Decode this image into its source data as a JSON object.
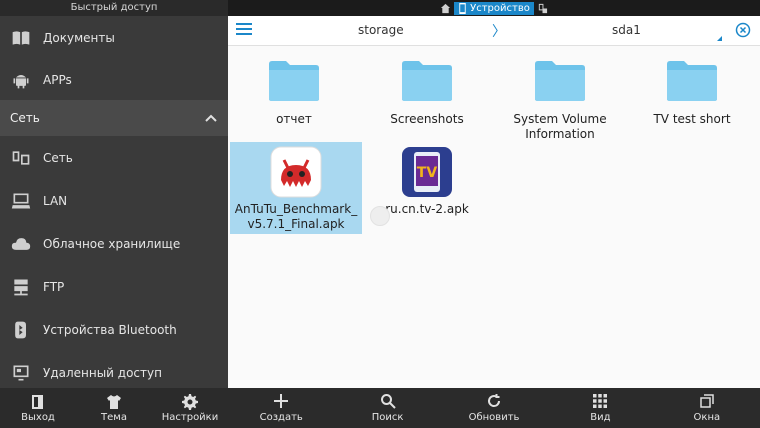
{
  "sidebar": {
    "title": "Быстрый доступ",
    "items_top": [
      {
        "label": "Документы",
        "icon": "book-icon"
      },
      {
        "label": "APPs",
        "icon": "android-icon"
      }
    ],
    "section": {
      "label": "Сеть",
      "expanded": true
    },
    "items_net": [
      {
        "label": "Сеть",
        "icon": "network-devices-icon"
      },
      {
        "label": "LAN",
        "icon": "computer-icon"
      },
      {
        "label": "Облачное хранилище",
        "icon": "cloud-icon"
      },
      {
        "label": "FTP",
        "icon": "ftp-server-icon"
      },
      {
        "label": "Устройства Bluetooth",
        "icon": "bluetooth-icon"
      },
      {
        "label": "Удаленный доступ",
        "icon": "remote-access-icon"
      }
    ],
    "bottom": [
      {
        "label": "Выход",
        "icon": "exit-icon"
      },
      {
        "label": "Тема",
        "icon": "tshirt-icon"
      },
      {
        "label": "Настройки",
        "icon": "gear-icon"
      }
    ]
  },
  "sysbar": {
    "device_label": "Устройство"
  },
  "path": {
    "crumb1": "storage",
    "separator": "〉",
    "crumb2": "sda1"
  },
  "files": [
    {
      "name": "отчет",
      "type": "folder"
    },
    {
      "name": "Screenshots",
      "type": "folder"
    },
    {
      "name": "System Volume Information",
      "type": "folder"
    },
    {
      "name": "TV test short",
      "type": "folder"
    },
    {
      "name": "AnTuTu_Benchmark_v5.7.1_Final.apk",
      "type": "apk",
      "selected": true
    },
    {
      "name": "ru.cn.tv-2.apk",
      "type": "apk"
    }
  ],
  "toolbar": [
    {
      "label": "Создать",
      "icon": "plus-icon"
    },
    {
      "label": "Поиск",
      "icon": "search-icon"
    },
    {
      "label": "Обновить",
      "icon": "refresh-icon"
    },
    {
      "label": "Вид",
      "icon": "grid-view-icon"
    },
    {
      "label": "Окна",
      "icon": "windows-icon"
    }
  ],
  "colors": {
    "accent": "#1b87c9",
    "sidebar_bg": "#3a3a3a",
    "selection": "#a9d8f0",
    "folder": "#6ec3ea"
  }
}
